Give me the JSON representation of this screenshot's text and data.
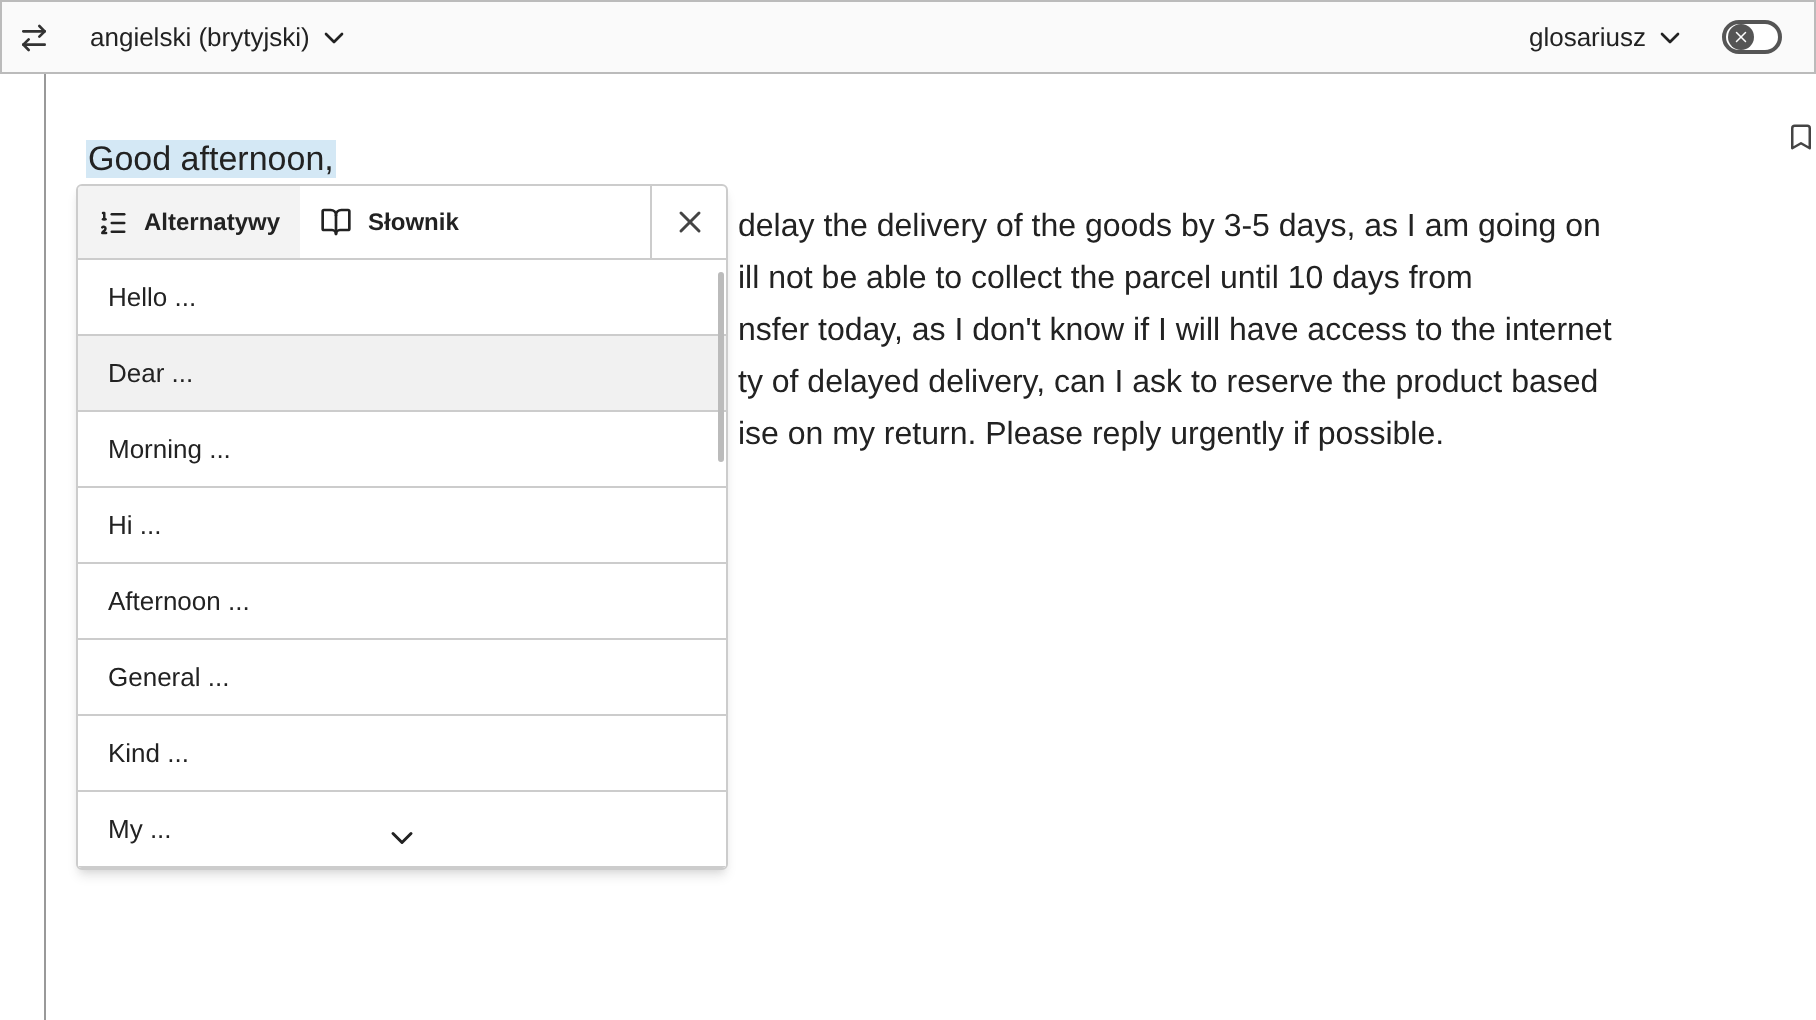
{
  "toolbar": {
    "language": "angielski (brytyjski)",
    "glossary": "glosariusz",
    "glossary_toggle": {
      "on": false
    }
  },
  "document": {
    "greeting": "Good afternoon,",
    "greeting_highlighted": true,
    "visible_line_fragments": [
      "delay the delivery of the goods by 3-5 days, as I am going on",
      "ill not be able to collect the parcel until 10 days from",
      "nsfer today, as I don't know if I will have access to the internet",
      "ty of delayed delivery, can I ask to reserve the product based",
      "ise on my return. Please reply urgently if possible."
    ]
  },
  "popup": {
    "tabs": [
      {
        "kind": "alternatives",
        "label": "Alternatywy",
        "selected": true
      },
      {
        "kind": "dictionary",
        "label": "Słownik",
        "selected": false
      }
    ],
    "items": [
      {
        "label": "Hello ...",
        "selected": false
      },
      {
        "label": "Dear ...",
        "selected": true
      },
      {
        "label": "Morning ...",
        "selected": false
      },
      {
        "label": "Hi ...",
        "selected": false
      },
      {
        "label": "Afternoon ...",
        "selected": false
      },
      {
        "label": "General ...",
        "selected": false
      },
      {
        "label": "Kind ...",
        "selected": false
      },
      {
        "label": "My ...",
        "selected": false
      }
    ]
  }
}
